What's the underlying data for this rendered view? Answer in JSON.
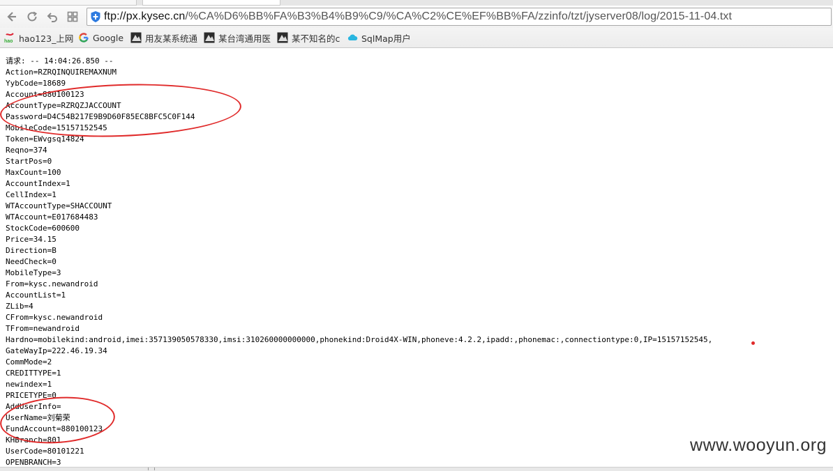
{
  "browser": {
    "url_domain": "ftp://px.kysec.cn",
    "url_path": "/%CA%D6%BB%FA%B3%B4%B9%C9/%CA%C2%CE%EF%BB%FA/zzinfo/tzt/jyserver08/log/2015-11-04.txt"
  },
  "bookmarks": [
    {
      "label": "hao123_上网",
      "icon": "hao123-icon"
    },
    {
      "label": "Google",
      "icon": "google-icon"
    },
    {
      "label": "用友某系统通",
      "icon": "site-icon"
    },
    {
      "label": "某台湾通用医",
      "icon": "site-icon"
    },
    {
      "label": "某不知名的c",
      "icon": "site-icon"
    },
    {
      "label": "SqlMap用户",
      "icon": "cloud-icon"
    }
  ],
  "log_lines": [
    "请求: -- 14:04:26.850 --",
    "Action=RZRQINQUIREMAXNUM",
    "YybCode=18689",
    "Account=880100123",
    "AccountType=RZRQZJACCOUNT",
    "Password=D4C54B217E9B9D60F85EC8BFC5C0F144",
    "MobileCode=15157152545",
    "Token=EWvgsq14824",
    "Reqno=374",
    "StartPos=0",
    "MaxCount=100",
    "AccountIndex=1",
    "CellIndex=1",
    "WTAccountType=SHACCOUNT",
    "WTAccount=E017684483",
    "StockCode=600600",
    "Price=34.15",
    "Direction=B",
    "NeedCheck=0",
    "MobileType=3",
    "From=kysc.newandroid",
    "AccountList=1",
    "ZLib=4",
    "CFrom=kysc.newandroid",
    "TFrom=newandroid",
    "Hardno=mobilekind:android,imei:357139050578330,imsi:310260000000000,phonekind:Droid4X-WIN,phoneve:4.2.2,ipadd:,phonemac:,connectiontype:0,IP=15157152545,",
    "GateWayIp=222.46.19.34",
    "CommMode=2",
    "CREDITTYPE=1",
    "newindex=1",
    "PRICETYPE=0",
    "AddUserInfo=",
    "UserName=刘菊荣",
    "FundAccount=880100123",
    "KHBranch=801",
    "UserCode=80101221",
    "OPENBRANCH=3"
  ],
  "watermark": "www.wooyun.org",
  "colors": {
    "annotation": "#e02a2a",
    "page_background": "#ffffff",
    "text": "#000000"
  }
}
